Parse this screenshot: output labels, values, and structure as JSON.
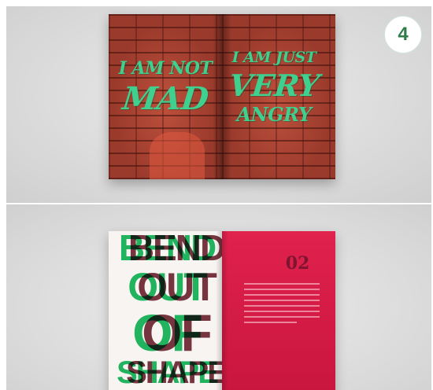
{
  "top_spread": {
    "left_line1": "I AM NOT",
    "left_line2": "MAD",
    "right_line1": "I AM JUST",
    "right_line2": "VERY",
    "right_line3": "ANGRY"
  },
  "badge": {
    "number": "4"
  },
  "bottom_spread": {
    "word1": "BEND",
    "word2": "OUT",
    "word3": "OF",
    "word4": "SHAPE",
    "page_number": "02"
  },
  "colors": {
    "accent_green": "#3fcf8e",
    "brick_red": "#9a3a2c",
    "magazine_red": "#d21a44",
    "badge_green": "#2f7d4b"
  }
}
